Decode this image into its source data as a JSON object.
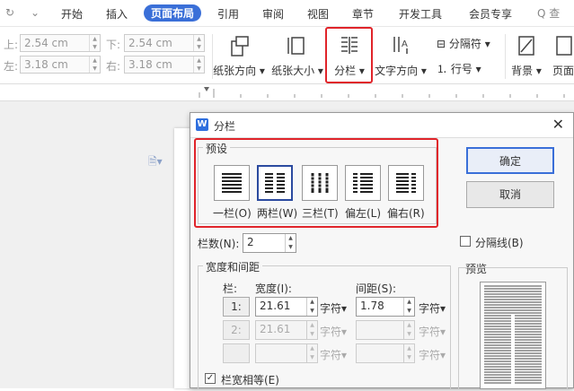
{
  "menubar": {
    "tabs": [
      "开始",
      "插入",
      "页面布局",
      "引用",
      "审阅",
      "视图",
      "章节",
      "开发工具",
      "会员专享"
    ],
    "active_tab": "页面布局",
    "search_label": "Q 查"
  },
  "margins": {
    "top_label": "上:",
    "top_value": "2.54 cm",
    "bottom_label": "下:",
    "bottom_value": "2.54 cm",
    "left_label": "左:",
    "left_value": "3.18 cm",
    "right_label": "右:",
    "right_value": "3.18 cm"
  },
  "ribbon": {
    "orientation": "纸张方向",
    "size": "纸张大小",
    "columns": "分栏",
    "text_direction": "文字方向",
    "page_break": "分隔符",
    "line_number": "行号",
    "background": "背景",
    "page_border": "页面"
  },
  "dialog": {
    "title": "分栏",
    "logo": "W",
    "preset_title": "预设",
    "presets": [
      "一栏(O)",
      "两栏(W)",
      "三栏(T)",
      "偏左(L)",
      "偏右(R)"
    ],
    "ok": "确定",
    "cancel": "取消",
    "columns_label": "栏数(N):",
    "columns_value": "2",
    "separator_label": "分隔线(B)",
    "width_group": "宽度和间距",
    "col_header": "栏:",
    "width_header": "宽度(I):",
    "spacing_header": "间距(S):",
    "rows": [
      {
        "idx": "1:",
        "width": "21.61",
        "unit1": "字符",
        "spacing": "1.78",
        "unit2": "字符"
      },
      {
        "idx": "2:",
        "width": "21.61",
        "unit1": "字符",
        "spacing": "",
        "unit2": "字符"
      },
      {
        "idx": "",
        "width": "",
        "unit1": "字符",
        "spacing": "",
        "unit2": "字符"
      }
    ],
    "equal_width_label": "栏宽相等(E)",
    "preview_label": "预览"
  },
  "colors": {
    "accent": "#3a6fd8",
    "highlight": "#e0242a"
  }
}
